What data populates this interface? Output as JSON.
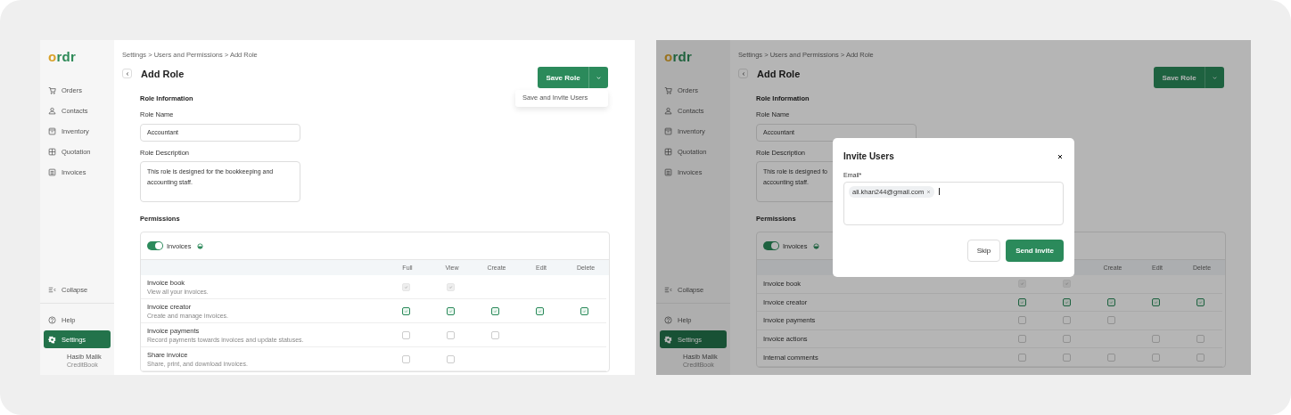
{
  "screens": [
    {
      "logo": "ordr",
      "breadcrumb": "Settings > Users and Permissions > Add Role",
      "title": "Add Role",
      "nav": [
        {
          "label": "Orders",
          "kind": "cart",
          "selected": false
        },
        {
          "label": "Contacts",
          "kind": "person",
          "selected": false
        },
        {
          "label": "Inventory",
          "kind": "box",
          "selected": false
        },
        {
          "label": "Quotation",
          "kind": "grid",
          "selected": false
        },
        {
          "label": "Invoices",
          "kind": "list",
          "selected": false
        }
      ],
      "collapse": "Collapse",
      "bottom_nav": [
        {
          "label": "Help",
          "kind": "help",
          "selected": false
        },
        {
          "label": "Settings",
          "kind": "gear",
          "selected": true
        }
      ],
      "user": {
        "name": "Hasib Malik",
        "company": "CreditBook"
      },
      "save_button": "Save Role",
      "save_menu": [
        "Save and Invite Users"
      ],
      "section_title": "Role Information",
      "name_label": "Role Name",
      "name_value": "Accountant",
      "description_label": "Role Description",
      "description_lines": [
        "This role is designed for the bookkeeping and",
        "accounting staff."
      ],
      "permissions_title": "Permissions",
      "module": {
        "label": "Invoices",
        "on": true
      },
      "columns": [
        {
          "label": "Full"
        },
        {
          "label": "View"
        },
        {
          "label": "Create"
        },
        {
          "label": "Edit"
        },
        {
          "label": "Delete"
        }
      ],
      "rows": [
        {
          "name": "Invoice book",
          "description": "View all your invoices.",
          "cells": [
            {
              "kind": "box",
              "checked": true,
              "disabled": true
            },
            {
              "kind": "box",
              "checked": true,
              "disabled": true
            },
            {
              "kind": "blank"
            },
            {
              "kind": "blank"
            },
            {
              "kind": "blank"
            }
          ]
        },
        {
          "name": "Invoice creator",
          "description": "Create and manage invoices.",
          "cells": [
            {
              "kind": "box",
              "checked": true,
              "disabled": false
            },
            {
              "kind": "box",
              "checked": true,
              "disabled": false
            },
            {
              "kind": "box",
              "checked": true,
              "disabled": false
            },
            {
              "kind": "box",
              "checked": true,
              "disabled": false
            },
            {
              "kind": "box",
              "checked": true,
              "disabled": false
            }
          ]
        },
        {
          "name": "Invoice payments",
          "description": "Record payments towards invoices and update statuses.",
          "cells": [
            {
              "kind": "box",
              "checked": false,
              "disabled": false
            },
            {
              "kind": "box",
              "checked": false,
              "disabled": false
            },
            {
              "kind": "box",
              "checked": false,
              "disabled": false
            },
            {
              "kind": "blank"
            },
            {
              "kind": "blank"
            }
          ]
        },
        {
          "name": "Share invoice",
          "description": "Share, print, and download invoices.",
          "cells": [
            {
              "kind": "box",
              "checked": false,
              "disabled": false
            },
            {
              "kind": "box",
              "checked": false,
              "disabled": false
            },
            {
              "kind": "blank"
            },
            {
              "kind": "blank"
            },
            {
              "kind": "blank"
            }
          ]
        }
      ]
    },
    {
      "logo": "ordr",
      "breadcrumb": "Settings > Users and Permissions > Add Role",
      "title": "Add Role",
      "nav": [
        {
          "label": "Orders",
          "kind": "cart",
          "selected": false
        },
        {
          "label": "Contacts",
          "kind": "person",
          "selected": false
        },
        {
          "label": "Inventory",
          "kind": "box",
          "selected": false
        },
        {
          "label": "Quotation",
          "kind": "grid",
          "selected": false
        },
        {
          "label": "Invoices",
          "kind": "list",
          "selected": false
        }
      ],
      "collapse": "Collapse",
      "bottom_nav": [
        {
          "label": "Help",
          "kind": "help",
          "selected": false
        },
        {
          "label": "Settings",
          "kind": "gear",
          "selected": true
        }
      ],
      "user": {
        "name": "Hasib Malik",
        "company": "CreditBook"
      },
      "save_button": "Save Role",
      "section_title": "Role Information",
      "name_label": "Role Name",
      "name_value": "Accountant",
      "description_label": "Role Description",
      "description_lines": [
        "This role is designed fo",
        "accounting staff."
      ],
      "permissions_title": "Permissions",
      "module": {
        "label": "Invoices",
        "on": true
      },
      "columns": [
        {},
        {},
        {
          "label": "Create"
        },
        {
          "label": "Edit"
        },
        {
          "label": "Delete"
        }
      ],
      "rows": [
        {
          "name": "Invoice book",
          "cells": [
            {
              "kind": "box",
              "checked": true,
              "disabled": true
            },
            {
              "kind": "box",
              "checked": true,
              "disabled": true
            },
            {
              "kind": "blank"
            },
            {
              "kind": "blank"
            },
            {
              "kind": "blank"
            }
          ]
        },
        {
          "name": "Invoice creator",
          "cells": [
            {
              "kind": "box",
              "checked": true,
              "disabled": false
            },
            {
              "kind": "box",
              "checked": true,
              "disabled": false
            },
            {
              "kind": "box",
              "checked": true,
              "disabled": false
            },
            {
              "kind": "box",
              "checked": true,
              "disabled": false
            },
            {
              "kind": "box",
              "checked": true,
              "disabled": false
            }
          ]
        },
        {
          "name": "Invoice payments",
          "cells": [
            {
              "kind": "box",
              "checked": false,
              "disabled": false
            },
            {
              "kind": "box",
              "checked": false,
              "disabled": false
            },
            {
              "kind": "box",
              "checked": false,
              "disabled": false
            },
            {
              "kind": "blank"
            },
            {
              "kind": "blank"
            }
          ]
        },
        {
          "name": "Invoice actions",
          "cells": [
            {
              "kind": "box",
              "checked": false,
              "disabled": false
            },
            {
              "kind": "box",
              "checked": false,
              "disabled": false
            },
            {
              "kind": "blank"
            },
            {
              "kind": "box",
              "checked": false,
              "disabled": false
            },
            {
              "kind": "box",
              "checked": false,
              "disabled": false
            }
          ]
        },
        {
          "name": "Internal comments",
          "cells": [
            {
              "kind": "box",
              "checked": false,
              "disabled": false
            },
            {
              "kind": "box",
              "checked": false,
              "disabled": false
            },
            {
              "kind": "box",
              "checked": false,
              "disabled": false
            },
            {
              "kind": "box",
              "checked": false,
              "disabled": false
            },
            {
              "kind": "box",
              "checked": false,
              "disabled": false
            }
          ]
        }
      ],
      "modal": {
        "title": "Invite Users",
        "email_label": "Email*",
        "chips": [
          {
            "label": "ali.khan244@gmail.com"
          }
        ],
        "skip": "Skip",
        "send": "Send Invite"
      }
    }
  ]
}
